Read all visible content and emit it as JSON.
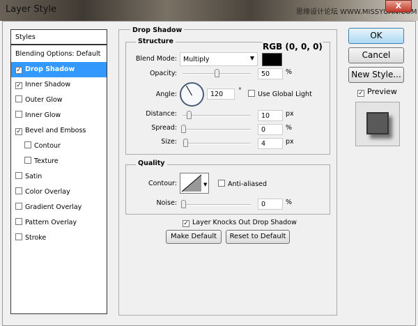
{
  "window": {
    "title": "Layer Style",
    "watermark": "思缘设计论坛 WWW.MISSYUAN.COM",
    "close": "X"
  },
  "styles_list": {
    "header": "Styles",
    "blending": "Blending Options: Default",
    "items": [
      {
        "label": "Drop Shadow",
        "checked": true,
        "selected": true
      },
      {
        "label": "Inner Shadow",
        "checked": true
      },
      {
        "label": "Outer Glow",
        "checked": false
      },
      {
        "label": "Inner Glow",
        "checked": false
      },
      {
        "label": "Bevel and Emboss",
        "checked": true
      },
      {
        "label": "Contour",
        "checked": false,
        "indent": true
      },
      {
        "label": "Texture",
        "checked": false,
        "indent": true
      },
      {
        "label": "Satin",
        "checked": false
      },
      {
        "label": "Color Overlay",
        "checked": false
      },
      {
        "label": "Gradient Overlay",
        "checked": false
      },
      {
        "label": "Pattern Overlay",
        "checked": false
      },
      {
        "label": "Stroke",
        "checked": false
      }
    ]
  },
  "panel": {
    "title": "Drop Shadow",
    "structure": {
      "title": "Structure",
      "annotation": "RGB (0, 0, 0)",
      "color": "#000000",
      "blend_mode_label": "Blend Mode:",
      "blend_mode": "Multiply",
      "opacity_label": "Opacity:",
      "opacity": "50",
      "opacity_unit": "%",
      "angle_label": "Angle:",
      "angle": "120",
      "angle_unit": "°",
      "global_light": "Use Global Light",
      "distance_label": "Distance:",
      "distance": "10",
      "distance_unit": "px",
      "spread_label": "Spread:",
      "spread": "0",
      "spread_unit": "%",
      "size_label": "Size:",
      "size": "4",
      "size_unit": "px"
    },
    "quality": {
      "title": "Quality",
      "contour_label": "Contour:",
      "anti_aliased": "Anti-aliased",
      "noise_label": "Noise:",
      "noise": "0",
      "noise_unit": "%"
    },
    "knocks_out": "Layer Knocks Out Drop Shadow",
    "make_default": "Make Default",
    "reset_default": "Reset to Default"
  },
  "buttons": {
    "ok": "OK",
    "cancel": "Cancel",
    "new_style": "New Style...",
    "preview": "Preview"
  }
}
